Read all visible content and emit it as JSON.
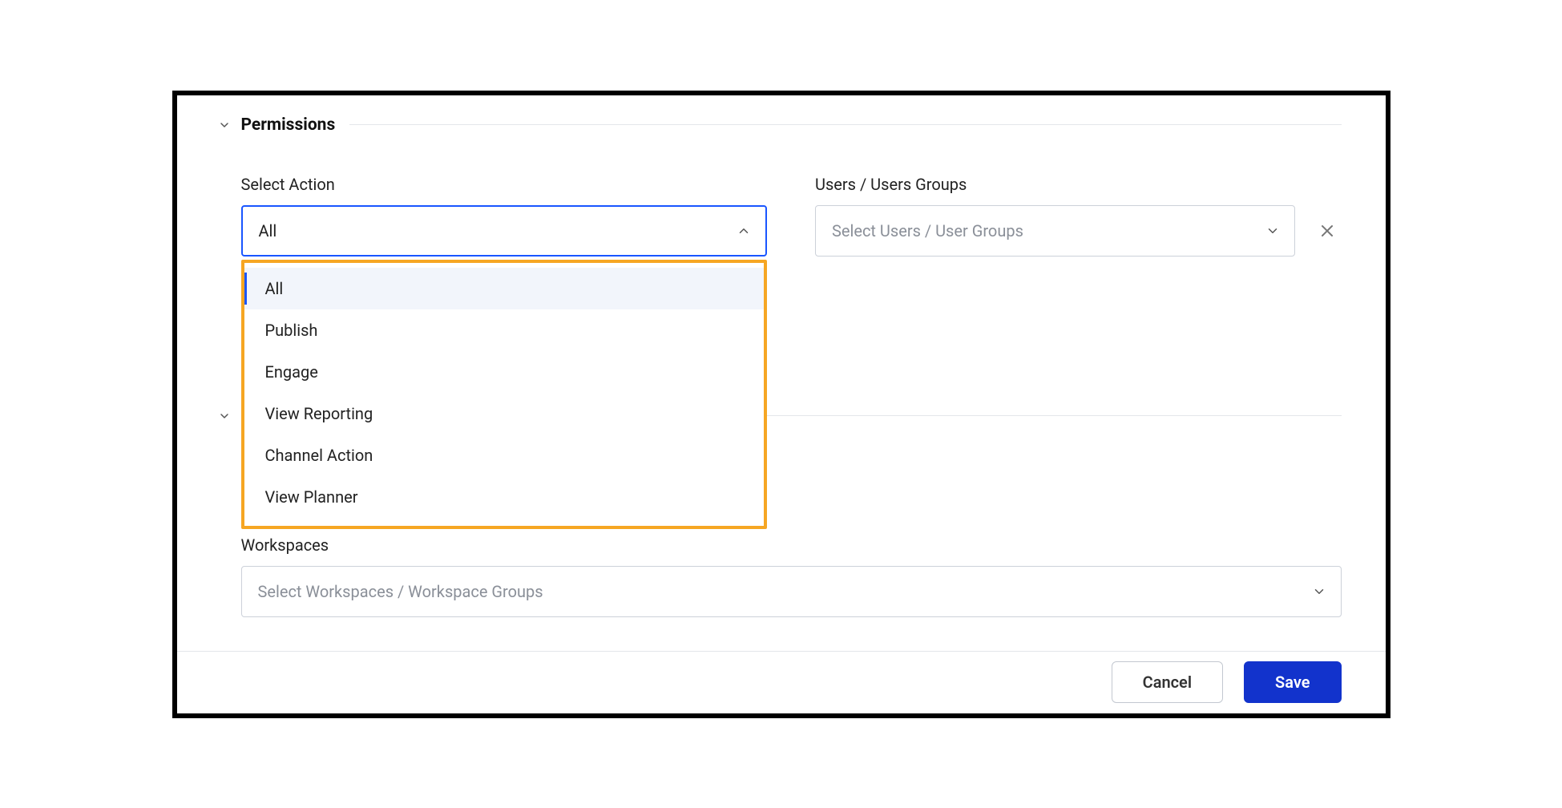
{
  "sections": {
    "permissions": {
      "title": "Permissions"
    },
    "second": {
      "title": ""
    }
  },
  "selectAction": {
    "label": "Select Action",
    "value": "All",
    "options": [
      "All",
      "Publish",
      "Engage",
      "View Reporting",
      "Channel Action",
      "View Planner"
    ]
  },
  "usersGroups": {
    "label": "Users / Users Groups",
    "placeholder": "Select Users / User Groups"
  },
  "workspaces": {
    "label": "Workspaces",
    "placeholder": "Select Workspaces / Workspace Groups"
  },
  "footer": {
    "cancel": "Cancel",
    "save": "Save"
  }
}
